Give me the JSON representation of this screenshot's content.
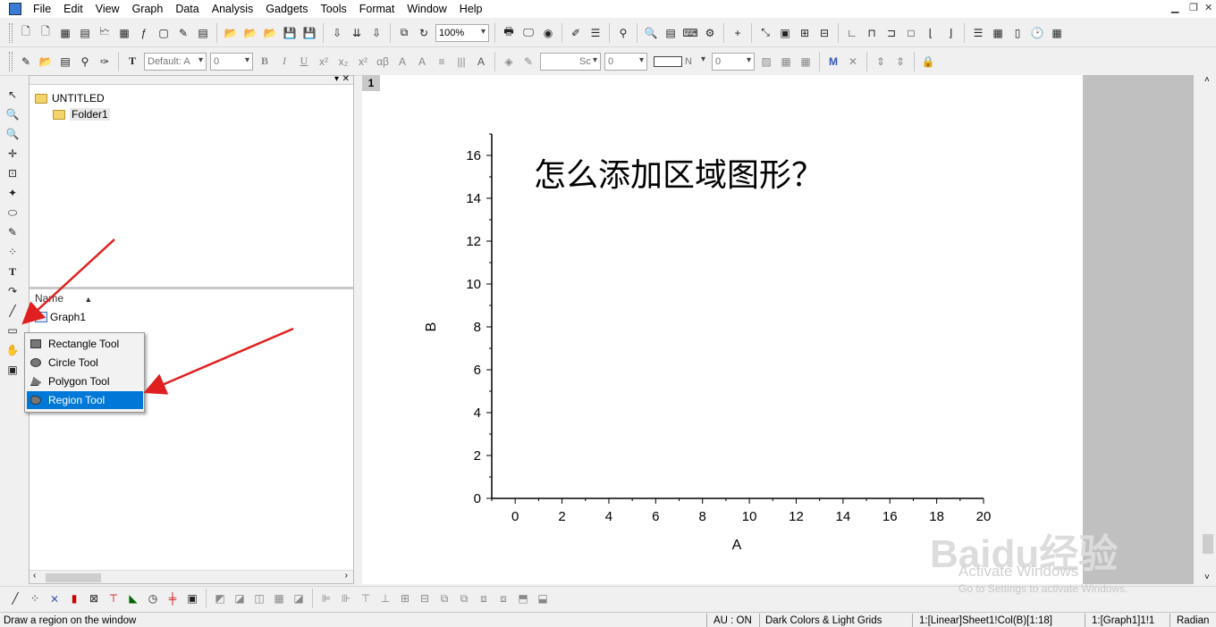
{
  "menu": [
    "File",
    "Edit",
    "View",
    "Graph",
    "Data",
    "Analysis",
    "Gadgets",
    "Tools",
    "Format",
    "Window",
    "Help"
  ],
  "toolbar": {
    "zoom_value": "100%",
    "font_value": "Default: A",
    "font_size_value": "0",
    "line_style_value": "Sc",
    "line_width_value": "0",
    "fill_color_value": "N",
    "fill_size_value": "0"
  },
  "explorer": {
    "project_name": "UNTITLED",
    "folder_name": "Folder1",
    "list_header": "Name",
    "items": [
      "Graph1"
    ]
  },
  "popup": {
    "items": [
      "Rectangle Tool",
      "Circle Tool",
      "Polygon Tool",
      "Region Tool"
    ],
    "selected": "Region Tool"
  },
  "graph": {
    "layer_label": "1",
    "annotation": "怎么添加区域图形？"
  },
  "chart_data": {
    "type": "scatter",
    "x": [],
    "y": [],
    "xlabel": "A",
    "ylabel": "B",
    "xlim": [
      -1,
      20
    ],
    "ylim": [
      0,
      17
    ],
    "xticks": [
      "0",
      "2",
      "4",
      "6",
      "8",
      "10",
      "12",
      "14",
      "16",
      "18",
      "20"
    ],
    "yticks": [
      "0",
      "2",
      "4",
      "6",
      "8",
      "10",
      "12",
      "14",
      "16"
    ]
  },
  "status": {
    "hint": "Draw a region on the window",
    "au": "AU : ON",
    "theme": "Dark Colors & Light Grids",
    "column": "1:[Linear]Sheet1!Col(B)[1:18]",
    "graph": "1:[Graph1]1!1",
    "angle": "Radian"
  },
  "watermark": {
    "logo": "Baidu经验",
    "activate_title": "Activate Windows",
    "activate_sub": "Go to Settings to activate Windows."
  }
}
